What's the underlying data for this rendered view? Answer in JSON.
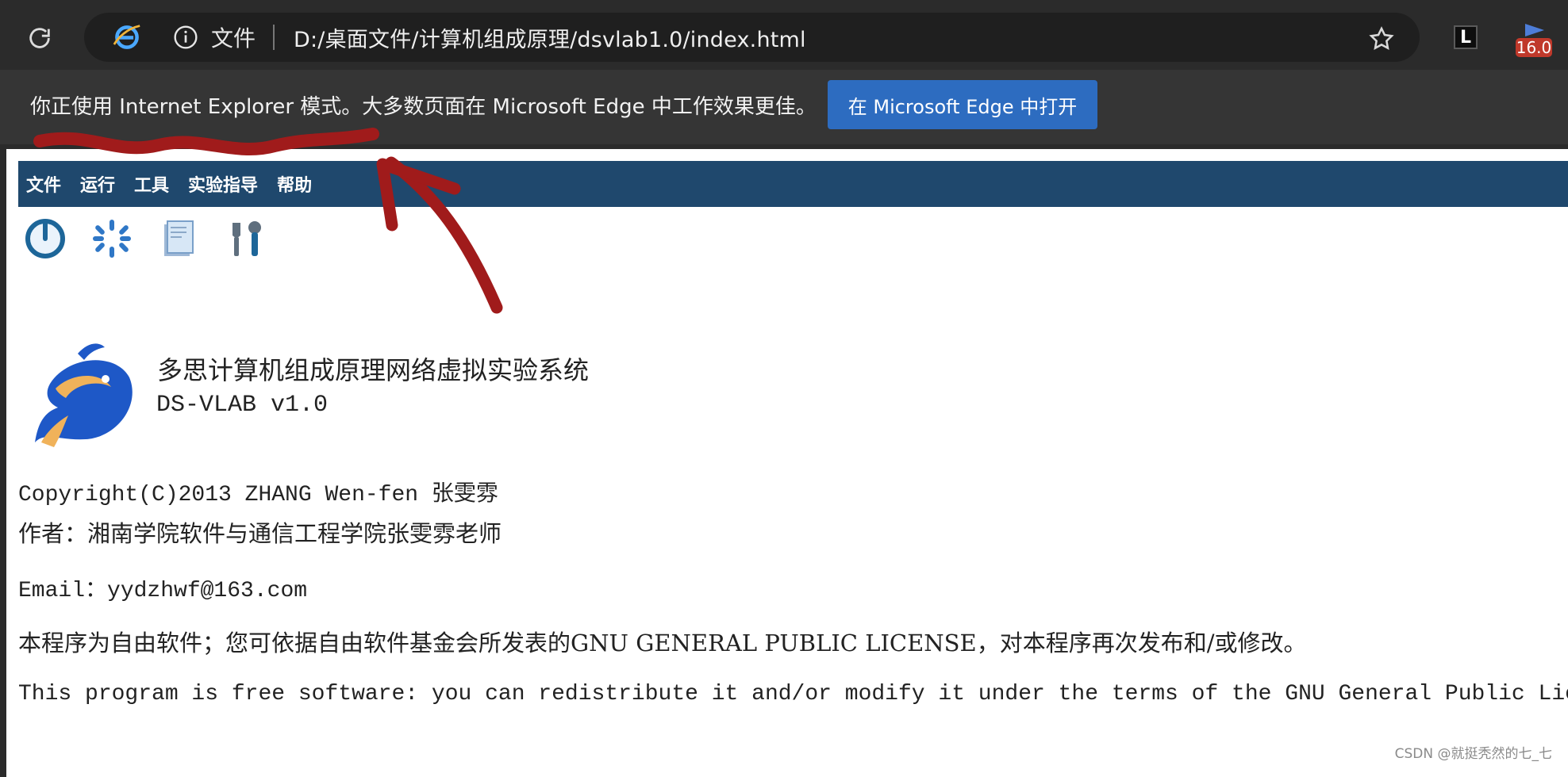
{
  "browser": {
    "address_scheme": "文件",
    "address_url": "D:/桌面文件/计算机组成原理/dsvlab1.0/index.html",
    "extension_letter": "L",
    "extension_badge": "16.0"
  },
  "ie_banner": {
    "message": "你正使用 Internet Explorer 模式。大多数页面在 Microsoft Edge 中工作效果更佳。",
    "open_button": "在 Microsoft Edge 中打开"
  },
  "app": {
    "menu": [
      "文件",
      "运行",
      "工具",
      "实验指导",
      "帮助"
    ],
    "toolbar_icons": [
      "power-icon",
      "spinner-icon",
      "document-icon",
      "tools-icon"
    ],
    "title_cn": "多思计算机组成原理网络虚拟实验系统",
    "title_en": "DS-VLAB v1.0",
    "copyright": "Copyright(C)2013 ZHANG Wen-fen 张雯雰",
    "author": "作者：湘南学院软件与通信工程学院张雯雰老师",
    "email": "Email：yydzhwf@163.com",
    "license_cn": "本程序为自由软件；您可依据自由软件基金会所发表的GNU GENERAL PUBLIC LICENSE，对本程序再次发布和/或修改。",
    "license_en": "This program is free software: you can redistribute it and/or modify it under the terms of the GNU General Public License as"
  },
  "watermark": "CSDN @就挺秃然的七_七",
  "colors": {
    "menubar": "#1f486d",
    "banner_button": "#2d6cc0",
    "annotation": "#a01b1b"
  }
}
